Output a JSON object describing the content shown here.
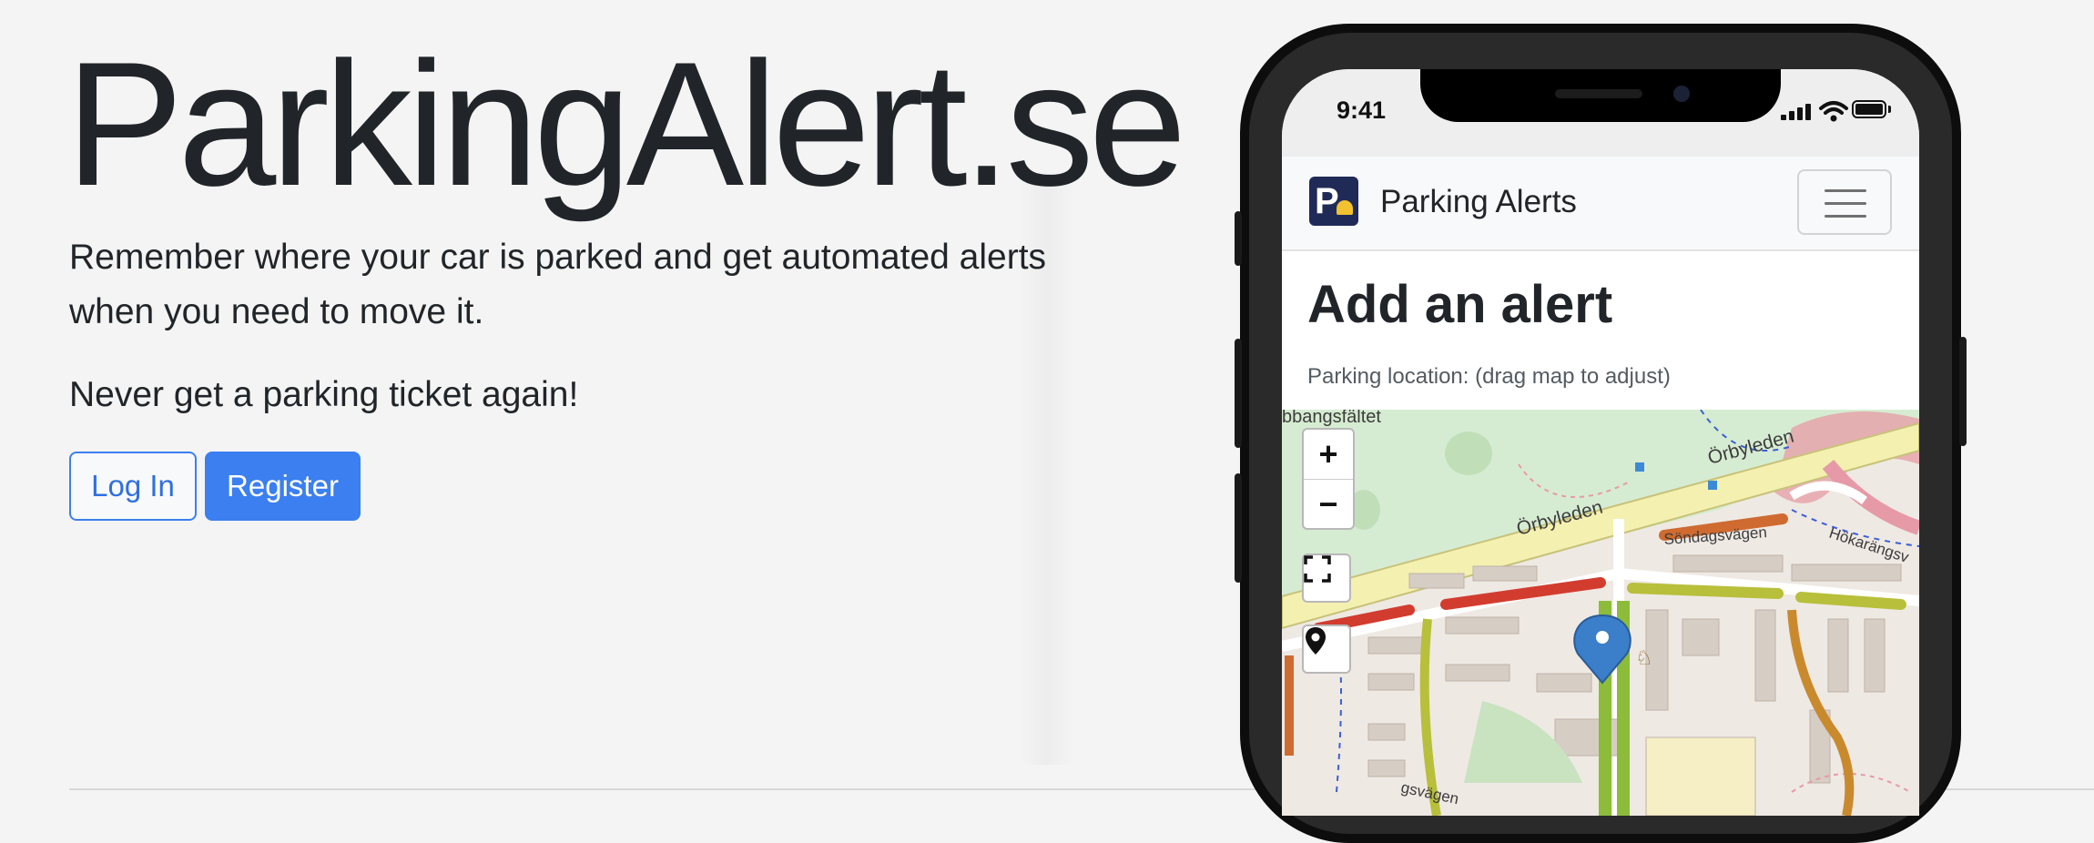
{
  "hero": {
    "title": "ParkingAlert.se",
    "lead": "Remember where your car is parked and get automated alerts when you need to move it.",
    "tagline": "Never get a parking ticket again!",
    "login_label": "Log In",
    "register_label": "Register"
  },
  "colors": {
    "primary": "#3b7ff0",
    "text": "#212529",
    "background": "#f4f4f4"
  },
  "phone": {
    "status_time": "9:41",
    "app": {
      "brand_name": "Parking Alerts",
      "brand_logo_letter": "P",
      "heading": "Add an alert",
      "location_label": "Parking location: (drag map to adjust)",
      "map": {
        "zoom_in": "+",
        "zoom_out": "−",
        "street_labels": [
          "Örbyleden",
          "Örbyleden",
          "Söndagsvägen",
          "Hökarängsv",
          "bbangsfältet",
          "gsvägen"
        ]
      }
    }
  }
}
